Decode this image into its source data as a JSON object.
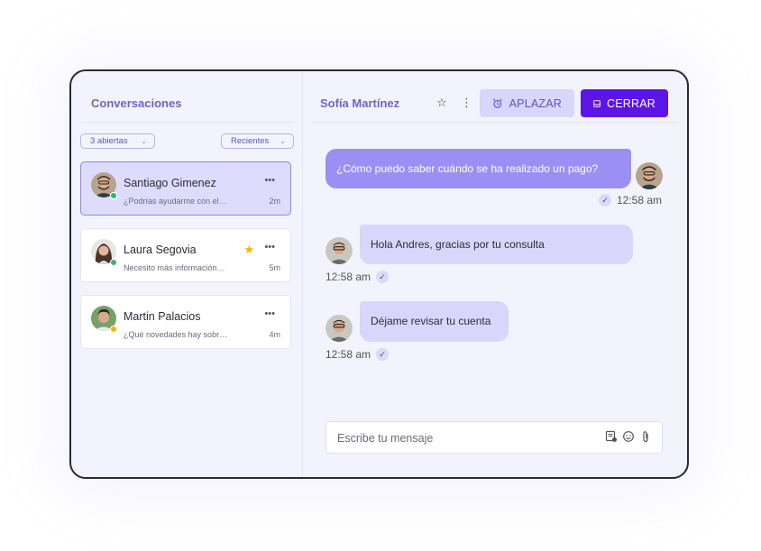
{
  "sidebar": {
    "title": "Conversaciones",
    "filters": {
      "status": "3 abiertas",
      "sort": "Recientes"
    },
    "conversations": [
      {
        "name": "Santiago Gimenez",
        "preview": "¿Podrías ayudarme con el…",
        "time": "2m",
        "active": true,
        "starred": false,
        "status_color": "#3bb26a"
      },
      {
        "name": "Laura Segovia",
        "preview": "Necesito más información…",
        "time": "5m",
        "active": false,
        "starred": true,
        "status_color": "#3bb26a"
      },
      {
        "name": "Martin Palacios",
        "preview": "¿Qué novedades hay sobr…",
        "time": "4m",
        "active": false,
        "starred": false,
        "status_color": "#f5b400"
      }
    ]
  },
  "chat": {
    "contact_name": "Sofía Martínez",
    "actions": {
      "snooze": "APLAZAR",
      "close": "CERRAR"
    },
    "messages": [
      {
        "direction": "outgoing",
        "text": "¿Cómo puedo saber cuándo se ha realizado un pago?",
        "time": "12:58 am"
      },
      {
        "direction": "incoming",
        "text": "Hola Andres, gracias por tu consulta",
        "time": "12:58 am"
      },
      {
        "direction": "incoming",
        "text": "Déjame revisar tu cuenta",
        "time": "12:58 am"
      }
    ],
    "composer": {
      "placeholder": "Escribe tu mensaje"
    }
  },
  "colors": {
    "accent": "#6e63c9",
    "primary_button": "#5b16e6",
    "bubble_out": "#9b8ff3",
    "bubble_in": "#d9d6fb"
  },
  "icons": [
    "chevron-down-icon",
    "more-icon",
    "star-icon",
    "kebab-icon",
    "alarm-clock-icon",
    "archive-icon",
    "check-icon",
    "template-icon",
    "emoji-icon",
    "attachment-icon"
  ]
}
